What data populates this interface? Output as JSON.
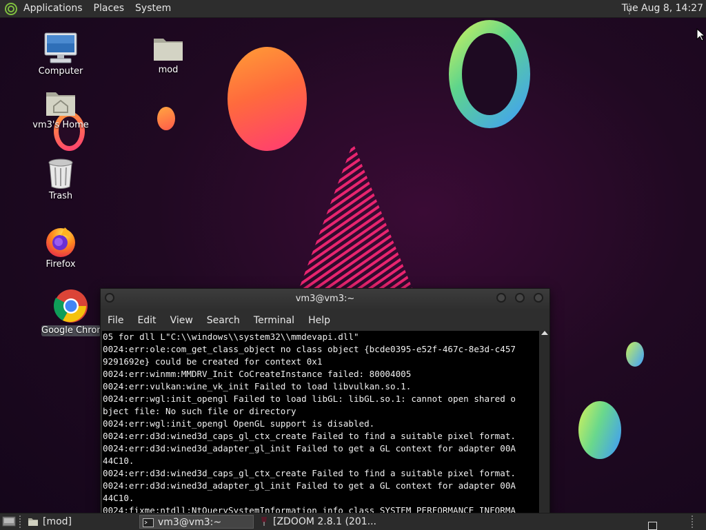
{
  "top_panel": {
    "menus": [
      "Applications",
      "Places",
      "System"
    ],
    "clock": "Tue Aug  8, 14:27"
  },
  "desktop": {
    "icons": [
      {
        "label": "Computer",
        "icon": "computer-icon"
      },
      {
        "label": "mod",
        "icon": "folder-icon"
      },
      {
        "label": "vm3's Home",
        "icon": "home-folder-icon"
      },
      {
        "label": "Trash",
        "icon": "trash-icon"
      },
      {
        "label": "Firefox",
        "icon": "firefox-icon"
      },
      {
        "label": "Google Chrome",
        "icon": "chrome-icon"
      }
    ]
  },
  "terminal": {
    "title": "vm3@vm3:~",
    "menu": [
      "File",
      "Edit",
      "View",
      "Search",
      "Terminal",
      "Help"
    ],
    "lines": [
      "05 for dll L\"C:\\\\windows\\\\system32\\\\mmdevapi.dll\"",
      "0024:err:ole:com_get_class_object no class object {bcde0395-e52f-467c-8e3d-c457",
      "9291692e} could be created for context 0x1",
      "0024:err:winmm:MMDRV_Init CoCreateInstance failed: 80004005",
      "0024:err:vulkan:wine_vk_init Failed to load libvulkan.so.1.",
      "0024:err:wgl:init_opengl Failed to load libGL: libGL.so.1: cannot open shared o",
      "bject file: No such file or directory",
      "0024:err:wgl:init_opengl OpenGL support is disabled.",
      "0024:err:d3d:wined3d_caps_gl_ctx_create Failed to find a suitable pixel format.",
      "0024:err:d3d:wined3d_adapter_gl_init Failed to get a GL context for adapter 00A",
      "44C10.",
      "0024:err:d3d:wined3d_caps_gl_ctx_create Failed to find a suitable pixel format.",
      "0024:err:d3d:wined3d_adapter_gl_init Failed to get a GL context for adapter 00A",
      "44C10.",
      "0024:fixme:ntdll:NtQuerySystemInformation info_class SYSTEM_PERFORMANCE_INFORMA"
    ]
  },
  "taskbar": {
    "tasks": [
      "[mod]",
      "vm3@vm3:~",
      "[ZDOOM 2.8.1 (201..."
    ]
  }
}
